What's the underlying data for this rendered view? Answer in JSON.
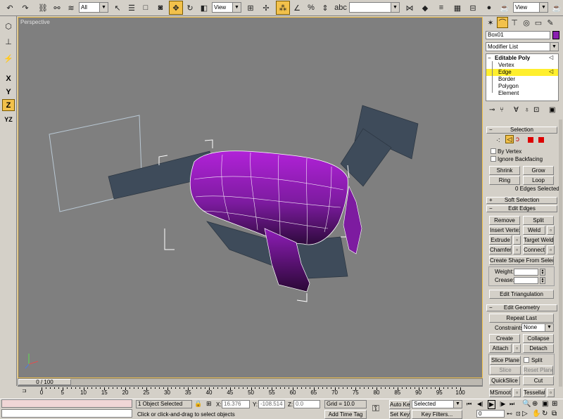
{
  "toolbar": {
    "selection_filter": "All",
    "ref_coord": "View",
    "ref_coord2": "View",
    "named_selection": ""
  },
  "viewport": {
    "label": "Perspective"
  },
  "left_toolbar": {
    "axis_x": "X",
    "axis_y": "Y",
    "axis_z": "Z",
    "axis_yz": "YZ"
  },
  "command_panel": {
    "object_name": "Box01",
    "object_color": "#8a1fb0",
    "modifier_list": "Modifier List",
    "stack": {
      "root": "Editable Poly",
      "items": [
        "Vertex",
        "Edge",
        "Border",
        "Polygon",
        "Element"
      ],
      "selected": "Edge"
    },
    "selection": {
      "title": "Selection",
      "by_vertex": "By Vertex",
      "ignore_backfacing": "Ignore Backfacing",
      "shrink": "Shrink",
      "grow": "Grow",
      "ring": "Ring",
      "loop": "Loop",
      "status": "0 Edges Selected"
    },
    "soft_selection": {
      "title": "Soft Selection"
    },
    "edit_edges": {
      "title": "Edit Edges",
      "remove": "Remove",
      "split": "Split",
      "insert_vertex": "Insert Vertex",
      "weld": "Weld",
      "extrude": "Extrude",
      "target_weld": "Target Weld",
      "chamfer": "Chamfer",
      "connect": "Connect",
      "create_shape": "Create Shape From Selection",
      "weight": "Weight:",
      "crease": "Crease:",
      "edit_triangulation": "Edit Triangulation"
    },
    "edit_geometry": {
      "title": "Edit Geometry",
      "repeat_last": "Repeat Last",
      "constraints": "Constraints:",
      "constraints_value": "None",
      "create": "Create",
      "collapse": "Collapse",
      "attach": "Attach",
      "detach": "Detach",
      "slice_plane": "Slice Plane",
      "split": "Split",
      "slice": "Slice",
      "reset_plane": "Reset Plane",
      "quickslice": "QuickSlice",
      "cut": "Cut",
      "msmooth": "MSmooth",
      "tessellate": "Tessellate"
    }
  },
  "timeline": {
    "slider": "0 / 100",
    "ticks": [
      "0",
      "5",
      "10",
      "15",
      "20",
      "25",
      "30",
      "35",
      "40",
      "45",
      "50",
      "55",
      "60",
      "65",
      "70",
      "75",
      "80",
      "85",
      "90",
      "95",
      "100"
    ]
  },
  "status_bar": {
    "object_selected": "1 Object Selected",
    "prompt": "Click or click-and-drag to select objects",
    "x_label": "X:",
    "x_value": "16.376",
    "y_label": "Y:",
    "y_value": "-108.514",
    "z_label": "Z:",
    "z_value": "0.0",
    "grid": "Grid = 10.0",
    "add_time_tag": "Add Time Tag",
    "auto_key": "Auto Key",
    "set_key": "Set Key",
    "selected_dd": "Selected",
    "key_filters": "Key Filters...",
    "frame": "0"
  }
}
